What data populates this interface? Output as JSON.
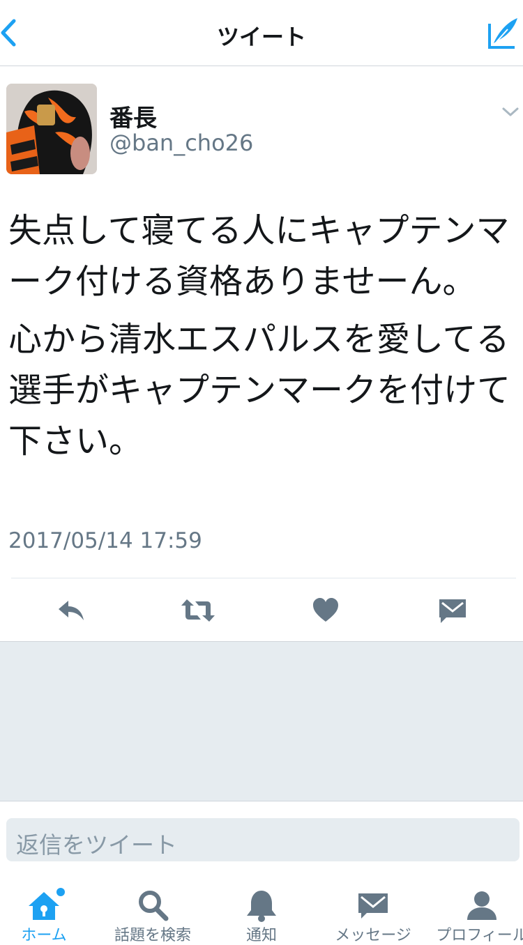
{
  "nav": {
    "title": "ツイート"
  },
  "tweet": {
    "name": "番長",
    "handle": "@ban_cho26",
    "paragraphs": [
      "失点して寝てる人にキャプテンマーク付ける資格ありませーん。",
      "心から清水エスパルスを愛してる選手がキャプテンマークを付けて下さい。"
    ],
    "timestamp": "2017/05/14 17:59"
  },
  "reply": {
    "placeholder": "返信をツイート"
  },
  "tabbar": {
    "items": [
      {
        "label": "ホーム",
        "icon": "home-icon",
        "active": true
      },
      {
        "label": "話題を検索",
        "icon": "search-icon"
      },
      {
        "label": "通知",
        "icon": "bell-icon"
      },
      {
        "label": "メッセージ",
        "icon": "envelope-icon"
      },
      {
        "label": "プロフィール",
        "icon": "person-icon"
      }
    ]
  },
  "colors": {
    "accent": "#1da1f2",
    "muted": "#657786",
    "actions": "#657786"
  }
}
